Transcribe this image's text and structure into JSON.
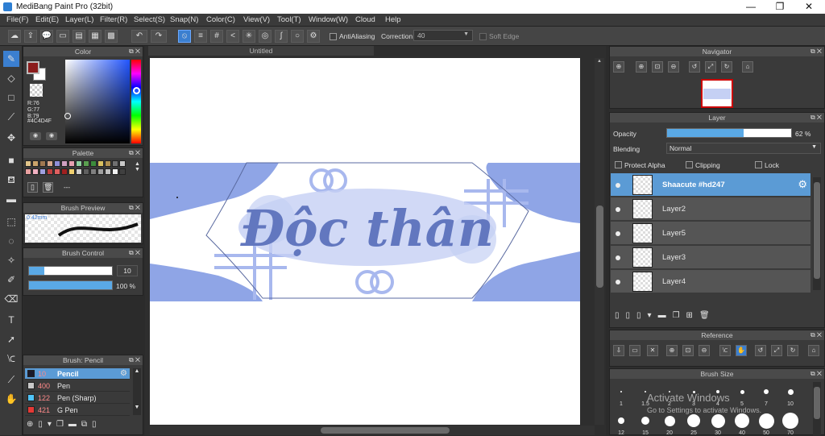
{
  "title": "MediBang Paint Pro (32bit)",
  "window_controls": {
    "minimize": "—",
    "maximize": "❐",
    "close": "✕"
  },
  "menu": [
    "File(F)",
    "Edit(E)",
    "Layer(L)",
    "Filter(R)",
    "Select(S)",
    "Snap(N)",
    "Color(C)",
    "View(V)",
    "Tool(T)",
    "Window(W)",
    "Cloud",
    "Help"
  ],
  "toolbar": {
    "antialiasing": "AntiAliasing",
    "correction_label": "Correction",
    "correction_value": "40",
    "soft_edge": "Soft Edge"
  },
  "color_panel": {
    "title": "Color",
    "r": "R:76",
    "g": "G:77",
    "b": "B:79",
    "hex": "#4C4D4F",
    "primary": "#8b1c1c",
    "secondary": "#ffffff"
  },
  "palette": {
    "title": "Palette",
    "more": "---",
    "swatches": [
      "#e0c48a",
      "#caa46b",
      "#a07850",
      "#d9a88c",
      "#8f8fd8",
      "#cfa0c0",
      "#e6a0b0",
      "#8fd0a0",
      "#5aa050",
      "#3c8c3c",
      "#d9c060",
      "#b09050",
      "#707070",
      "#c8c8c8",
      "#e8a0a0",
      "#f0b0c0",
      "#a0a0e0",
      "#c04040",
      "#e06060",
      "#a02020",
      "#f0d070",
      "#d0d0d0",
      "#606060",
      "#808080",
      "#a0a0a0",
      "#c0c0c0",
      "#f0f0f0",
      "#404040"
    ]
  },
  "brush_preview": {
    "title": "Brush Preview",
    "size": "0.42mm"
  },
  "brush_control": {
    "title": "Brush Control",
    "size_value": "10",
    "opacity_value": "100 %",
    "size_fraction": 0.18,
    "opacity_fraction": 1.0
  },
  "brush_list": {
    "title": "Brush: Pencil",
    "items": [
      {
        "size": "10",
        "name": "Pencil",
        "color": "#1a1a2a",
        "selected": true
      },
      {
        "size": "400",
        "name": "Pen",
        "color": "#c8c8c8",
        "selected": false
      },
      {
        "size": "122",
        "name": "Pen (Sharp)",
        "color": "#4fc3f7",
        "selected": false
      },
      {
        "size": "421",
        "name": "G Pen",
        "color": "#e53935",
        "selected": false
      }
    ]
  },
  "canvas": {
    "tab": "Untitled",
    "artwork_text": "Độc thân",
    "accent": "#a8b8ee",
    "banner_color": "#8fa5e6"
  },
  "navigator": {
    "title": "Navigator"
  },
  "layer_panel": {
    "title": "Layer",
    "opacity_label": "Opacity",
    "opacity_value": "62 %",
    "opacity_fraction": 0.62,
    "blending_label": "Blending",
    "blending_value": "Normal",
    "protect_alpha": "Protect Alpha",
    "clipping": "Clipping",
    "lock": "Lock",
    "layers": [
      {
        "name": "Shaacute #hd247",
        "selected": true
      },
      {
        "name": "Layer2",
        "selected": false
      },
      {
        "name": "Layer5",
        "selected": false
      },
      {
        "name": "Layer3",
        "selected": false
      },
      {
        "name": "Layer4",
        "selected": false
      }
    ]
  },
  "reference": {
    "title": "Reference"
  },
  "brush_size": {
    "title": "Brush Size",
    "row1": [
      "1",
      "1.5",
      "2",
      "3",
      "4",
      "5",
      "7",
      "10"
    ],
    "row2": [
      "12",
      "15",
      "20",
      "25",
      "30",
      "40",
      "50",
      "70"
    ]
  },
  "watermark": {
    "line1": "Activate Windows",
    "line2": "Go to Settings to activate Windows."
  }
}
